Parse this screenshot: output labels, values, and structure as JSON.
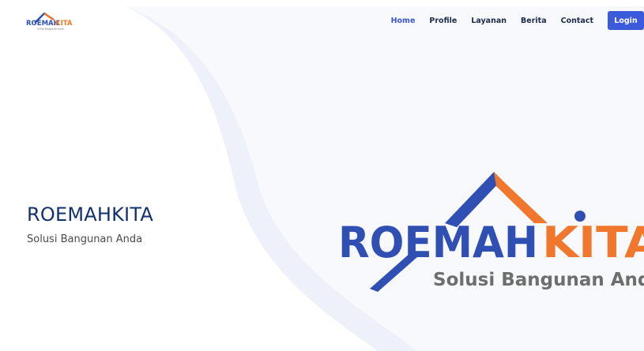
{
  "brand": {
    "logo_name_part1": "ROEMAH",
    "logo_name_part2": "KITA",
    "logo_tagline": "Solusi Bangunan Anda",
    "colors": {
      "blue": "#2f4fb3",
      "orange": "#f0772b",
      "gray": "#6e6e6e"
    }
  },
  "nav": {
    "links": [
      "Home",
      "Profile",
      "Layanan",
      "Berita",
      "Contact"
    ],
    "active": "Home",
    "login_label": "Login"
  },
  "hero": {
    "title": "ROEMAHKITA",
    "subtitle": "Solusi Bangunan Anda"
  }
}
